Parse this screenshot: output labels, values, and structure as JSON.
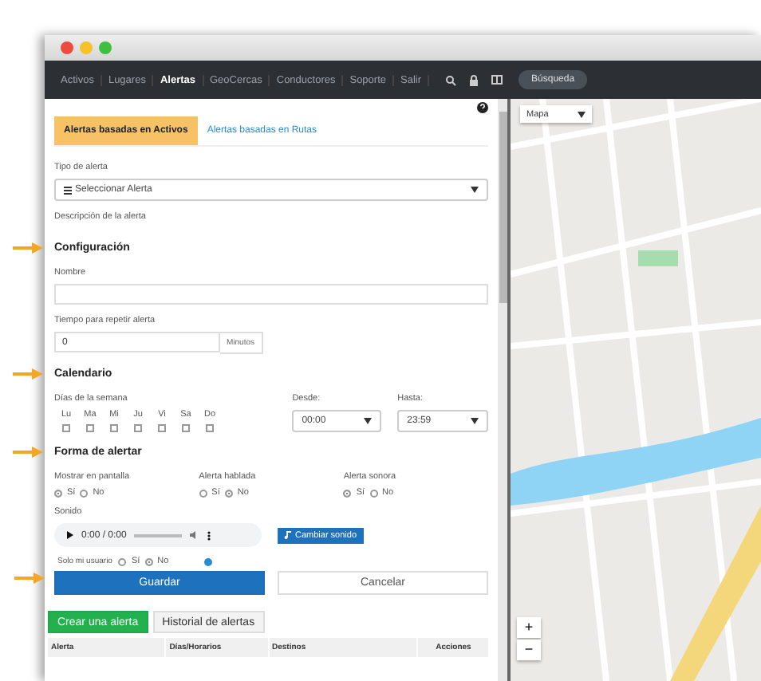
{
  "nav": {
    "items": [
      {
        "label": "Activos",
        "selected": false
      },
      {
        "label": "Lugares",
        "selected": false
      },
      {
        "label": "Alertas",
        "selected": true
      },
      {
        "label": "GeoCercas",
        "selected": false
      },
      {
        "label": "Conductores",
        "selected": false
      },
      {
        "label": "Soporte",
        "selected": false
      },
      {
        "label": "Salir",
        "selected": false
      }
    ],
    "search_button": "Búsqueda"
  },
  "tabs": [
    {
      "label": "Alertas basadas en Activos",
      "selected": true
    },
    {
      "label": "Alertas basadas en Rutas",
      "selected": false
    }
  ],
  "alert_type": {
    "label": "Tipo de alerta",
    "value": "Seleccionar Alerta"
  },
  "description_label": "Descripción de la alerta",
  "configuration": {
    "title": "Configuración",
    "highlighted": true,
    "name_label": "Nombre",
    "repeat_label": "Tiempo para repetir alerta",
    "repeat_value": "0",
    "repeat_unit": "Minutos"
  },
  "calendar": {
    "title": "Calendario",
    "highlighted": true,
    "days_label": "Días de la semana",
    "days": [
      {
        "label": "Lu",
        "checked": false
      },
      {
        "label": "Ma",
        "checked": false
      },
      {
        "label": "Mi",
        "checked": false
      },
      {
        "label": "Ju",
        "checked": false
      },
      {
        "label": "Vi",
        "checked": false
      },
      {
        "label": "Sa",
        "checked": false
      },
      {
        "label": "Do",
        "checked": false
      }
    ],
    "from": {
      "label": "Desde:",
      "value": "00:00"
    },
    "to": {
      "label": "Hasta:",
      "value": "23:59"
    }
  },
  "alert_mode": {
    "title": "Forma de alertar",
    "highlighted": true,
    "groups": [
      {
        "label": "Mostrar en pantalla",
        "options": [
          {
            "label": "Sí",
            "selected": true
          },
          {
            "label": "No",
            "selected": false
          }
        ]
      },
      {
        "label": "Alerta hablada",
        "options": [
          {
            "label": "Sí",
            "selected": false
          },
          {
            "label": "No",
            "selected": true
          }
        ]
      },
      {
        "label": "Alerta sonora",
        "options": [
          {
            "label": "Sí",
            "selected": true
          },
          {
            "label": "No",
            "selected": false
          }
        ]
      }
    ],
    "sound_label": "Sonido",
    "player_time": "0:00 / 0:00",
    "change_sound": "Cambiar sonido"
  },
  "only_mine": {
    "label": "Solo mi usuario",
    "options": [
      {
        "label": "Sí",
        "selected": false
      },
      {
        "label": "No",
        "selected": true
      }
    ]
  },
  "save": {
    "label": "Guardar",
    "highlighted": true
  },
  "cancel": "Cancelar",
  "bottom_tabs": [
    {
      "label": "Crear una alerta",
      "selected": true
    },
    {
      "label": "Historial de alertas",
      "selected": false
    }
  ],
  "table": {
    "columns": [
      "Alerta",
      "Días/Horarios",
      "Destinos",
      "Acciones"
    ]
  },
  "map": {
    "type_select": "Mapa",
    "zoom_in": "+",
    "zoom_out": "−"
  }
}
